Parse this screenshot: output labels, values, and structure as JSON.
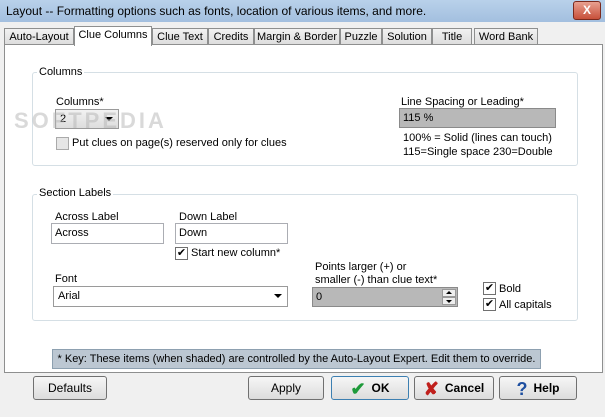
{
  "window": {
    "title": "Layout  --  Formatting options such as fonts, location of various items, and more.",
    "close": "X"
  },
  "tabs": [
    "Auto-Layout",
    "Clue Columns",
    "Clue Text",
    "Credits",
    "Margin & Border",
    "Puzzle",
    "Solution",
    "Title",
    "Word Bank"
  ],
  "active_tab": "Clue Columns",
  "columns": {
    "title": "Columns",
    "columns_label": "Columns*",
    "columns_value": "2",
    "reserved_label": "Put clues on page(s) reserved only for clues",
    "spacing_label": "Line Spacing or Leading*",
    "spacing_value": "115 %",
    "spacing_note1": "100% = Solid (lines can touch)",
    "spacing_note2": "115=Single space   230=Double"
  },
  "section_labels": {
    "title": "Section Labels",
    "across_label": "Across Label",
    "across_value": "Across",
    "down_label": "Down Label",
    "down_value": "Down",
    "start_new_column": "Start new column*",
    "font_label": "Font",
    "font_value": "Arial",
    "points_label_1": "Points larger (+) or",
    "points_label_2": "smaller (-) than clue text*",
    "points_value": "0",
    "bold_label": "Bold",
    "allcaps_label": "All capitals"
  },
  "key_note": "* Key:  These items (when shaded) are controlled by the Auto-Layout Expert.  Edit them to override.",
  "buttons": {
    "defaults": "Defaults",
    "apply": "Apply",
    "ok": "OK",
    "cancel": "Cancel",
    "help": "Help"
  },
  "colors": {
    "ok_check": "#1e9a3a",
    "cancel_x": "#c0201c",
    "help_q": "#1e4fa0"
  }
}
